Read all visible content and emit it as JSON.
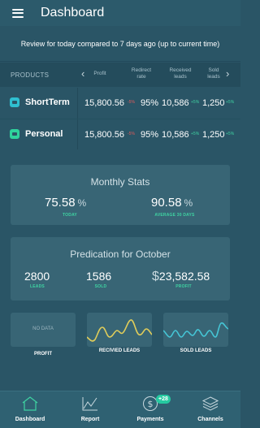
{
  "header": {
    "title": "Dashboard",
    "menu_icon": "hamburger-menu-icon"
  },
  "review_text": "Review for today compared to 7 days ago (up to current time)",
  "products_table": {
    "label": "PRODUCTS",
    "columns": [
      {
        "line1": "Profit",
        "line2": ""
      },
      {
        "line1": "Redirect",
        "line2": "rate"
      },
      {
        "line1": "Received",
        "line2": "leads"
      },
      {
        "line1": "Sold",
        "line2": "leads"
      }
    ],
    "rows": [
      {
        "name": "ShortTerm",
        "icon_color": "#2fbfd0",
        "profit": "15,800.56",
        "profit_delta": "-5%",
        "redirect": "95%",
        "received": "10,586",
        "received_delta": "+5%",
        "sold": "1,250",
        "sold_delta": "+5%"
      },
      {
        "name": "Personal",
        "icon_color": "#2fd39c",
        "profit": "15,800.56",
        "profit_delta": "-5%",
        "redirect": "95%",
        "received": "10,586",
        "received_delta": "+5%",
        "sold": "1,250",
        "sold_delta": "+5%"
      }
    ]
  },
  "monthly_stats": {
    "title": "Monthly Stats",
    "today_value": "75.58",
    "today_unit": "%",
    "today_label": "TODAY",
    "avg_value": "90.58",
    "avg_unit": "%",
    "avg_label": "AVERAGE 30 DAYS"
  },
  "prediction": {
    "title": "Predication for October",
    "leads_value": "2800",
    "leads_label": "LEADS",
    "sold_value": "1586",
    "sold_label": "SOLD",
    "profit_symbol": "$",
    "profit_value": "23,582.58",
    "profit_label": "PROFIT"
  },
  "mini_panels": {
    "profit": {
      "placeholder": "NO DATA",
      "label": "PROFIT"
    },
    "received": {
      "label": "RECIVIED LEADS",
      "line_color": "#e0cd5a"
    },
    "sold": {
      "label": "SOLD LEADS",
      "line_color": "#45c6d6"
    }
  },
  "bottom_nav": {
    "items": [
      {
        "label": "Dashboard",
        "icon": "home-icon"
      },
      {
        "label": "Report",
        "icon": "line-chart-icon"
      },
      {
        "label": "Payments",
        "icon": "dollar-circle-icon",
        "badge": "+28"
      },
      {
        "label": "Channels",
        "icon": "layers-icon"
      }
    ]
  },
  "colors": {
    "accent_green": "#3fd3a2",
    "negative_red": "#e25b5b",
    "background": "#2a5566",
    "card": "#386575"
  }
}
